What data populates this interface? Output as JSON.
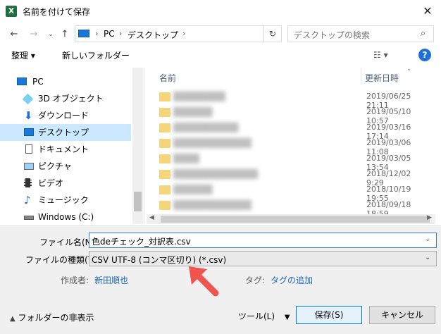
{
  "window": {
    "title": "名前を付けて保存",
    "app_icon": "X"
  },
  "address": {
    "crumbs": [
      "PC",
      "デスクトップ"
    ],
    "search_placeholder": "デスクトップの検索"
  },
  "toolbar": {
    "organize": "整理 ▾",
    "new_folder": "新しいフォルダー",
    "help": "?"
  },
  "nav": [
    {
      "label": "PC",
      "icon": "pc-icon"
    },
    {
      "label": "3D オブジェクト",
      "icon": "cube-icon"
    },
    {
      "label": "ダウンロード",
      "icon": "download-icon"
    },
    {
      "label": "デスクトップ",
      "icon": "desktop-icon",
      "selected": true
    },
    {
      "label": "ドキュメント",
      "icon": "document-icon"
    },
    {
      "label": "ピクチャ",
      "icon": "picture-icon"
    },
    {
      "label": "ビデオ",
      "icon": "video-icon"
    },
    {
      "label": "ミュージック",
      "icon": "music-icon"
    },
    {
      "label": "Windows (C:)",
      "icon": "drive-icon"
    }
  ],
  "files": {
    "col_name": "名前",
    "col_date": "更新日時",
    "rows": [
      {
        "date": "2019/06/25 21:11"
      },
      {
        "date": "2019/05/10 10:57"
      },
      {
        "date": "2019/03/16 17:14"
      },
      {
        "date": "2019/03/06 11:08"
      },
      {
        "date": "2019/03/05 13:54"
      },
      {
        "date": "2018/12/02 9:29"
      },
      {
        "date": "2018/10/19 19:55"
      },
      {
        "date": "2018/09/18 18:59"
      }
    ]
  },
  "form": {
    "filename_label": "ファイル名(N):",
    "filename_value": "色deチェック_対訳表.csv",
    "filetype_label": "ファイルの種類(T):",
    "filetype_value": "CSV UTF-8 (コンマ区切り) (*.csv)",
    "author_label": "作成者:",
    "author_value": "新田順也",
    "tag_label": "タグ:",
    "tag_value": "タグの追加"
  },
  "footer": {
    "hide_folders": "フォルダーの非表示",
    "tools": "ツール(L)",
    "save": "保存(S)",
    "cancel": "キャンセル"
  },
  "colors": {
    "selection": "#cce8ff",
    "accent": "#0078d7",
    "arrow": "#f0544f",
    "link": "#1a66b8"
  }
}
